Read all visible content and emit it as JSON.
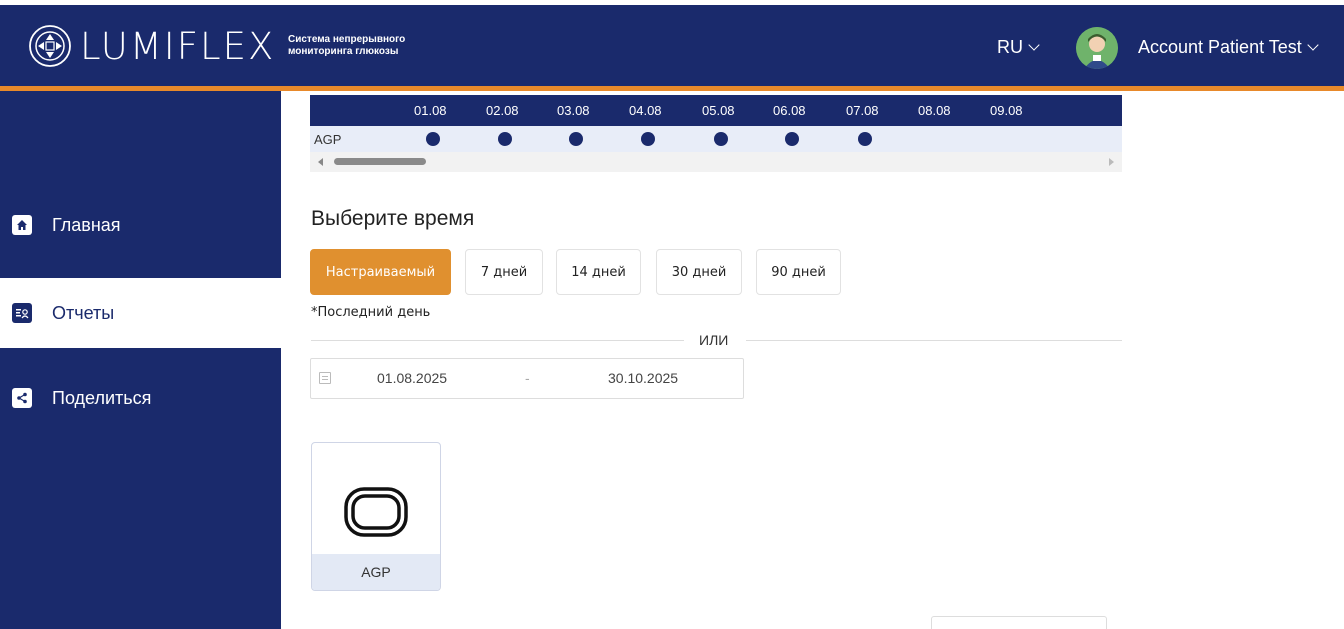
{
  "app": {
    "logo_text": "LUMIFLEX",
    "tagline": "Система непрерывного мониторинга глюкозы"
  },
  "header": {
    "language": "RU",
    "account_name": "Account Patient Test"
  },
  "colors": {
    "primary": "#1a2a6c",
    "accent": "#e0902f",
    "row_bg": "#e8edf8"
  },
  "sidebar": {
    "items": [
      {
        "label": "Главная",
        "icon": "home-icon",
        "active": false
      },
      {
        "label": "Отчеты",
        "icon": "reports-icon",
        "active": true
      },
      {
        "label": "Поделиться",
        "icon": "share-icon",
        "active": false
      }
    ]
  },
  "timeline": {
    "row_label": "AGP",
    "dates": [
      "01.08",
      "02.08",
      "03.08",
      "04.08",
      "05.08",
      "06.08",
      "07.08",
      "08.08",
      "09.08"
    ],
    "has_data": [
      true,
      true,
      true,
      true,
      true,
      true,
      true,
      false,
      false
    ]
  },
  "period": {
    "title": "Выберите время",
    "buttons": [
      "Настраиваемый",
      "7 дней",
      "14 дней",
      "30 дней",
      "90 дней"
    ],
    "active": "Настраиваемый",
    "note": "*Последний день",
    "or_text": "ИЛИ"
  },
  "date_range": {
    "from": "01.08.2025",
    "separator": "-",
    "to": "30.10.2025"
  },
  "reports": [
    {
      "label": "AGP",
      "icon": "agp-icon"
    }
  ]
}
